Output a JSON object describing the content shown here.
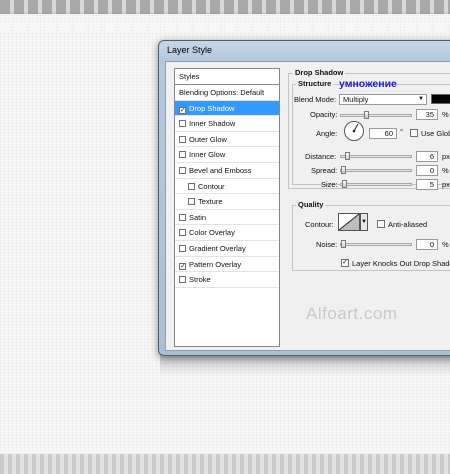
{
  "dialog": {
    "title": "Layer Style"
  },
  "styles_list": {
    "header": "Styles",
    "items": [
      {
        "label": "Blending Options: Default",
        "checkbox": false,
        "checked": false,
        "selected": false,
        "indent": false
      },
      {
        "label": "Drop Shadow",
        "checkbox": true,
        "checked": true,
        "selected": true,
        "indent": false
      },
      {
        "label": "Inner Shadow",
        "checkbox": true,
        "checked": false,
        "selected": false,
        "indent": false
      },
      {
        "label": "Outer Glow",
        "checkbox": true,
        "checked": false,
        "selected": false,
        "indent": false
      },
      {
        "label": "Inner Glow",
        "checkbox": true,
        "checked": false,
        "selected": false,
        "indent": false
      },
      {
        "label": "Bevel and Emboss",
        "checkbox": true,
        "checked": false,
        "selected": false,
        "indent": false
      },
      {
        "label": "Contour",
        "checkbox": true,
        "checked": false,
        "selected": false,
        "indent": true
      },
      {
        "label": "Texture",
        "checkbox": true,
        "checked": false,
        "selected": false,
        "indent": true
      },
      {
        "label": "Satin",
        "checkbox": true,
        "checked": false,
        "selected": false,
        "indent": false
      },
      {
        "label": "Color Overlay",
        "checkbox": true,
        "checked": false,
        "selected": false,
        "indent": false
      },
      {
        "label": "Gradient Overlay",
        "checkbox": true,
        "checked": false,
        "selected": false,
        "indent": false
      },
      {
        "label": "Pattern Overlay",
        "checkbox": true,
        "checked": true,
        "selected": false,
        "indent": false
      },
      {
        "label": "Stroke",
        "checkbox": true,
        "checked": false,
        "selected": false,
        "indent": false
      }
    ]
  },
  "drop_shadow": {
    "section_title": "Drop Shadow",
    "structure_title": "Structure",
    "annotation": "умножение",
    "blend_mode_label": "Blend Mode:",
    "blend_mode_value": "Multiply",
    "shadow_color": "#000000",
    "opacity_label": "Opacity:",
    "opacity_value": "35",
    "opacity_unit": "%",
    "angle_label": "Angle:",
    "angle_value": "60",
    "angle_unit": "°",
    "use_global_light_label": "Use Global",
    "distance_label": "Distance:",
    "distance_value": "6",
    "distance_unit": "px",
    "spread_label": "Spread:",
    "spread_value": "0",
    "spread_unit": "%",
    "size_label": "Size:",
    "size_value": "5",
    "size_unit": "px",
    "quality_title": "Quality",
    "contour_label": "Contour:",
    "anti_aliased_label": "Anti-aliased",
    "noise_label": "Noise:",
    "noise_value": "0",
    "noise_unit": "%",
    "knockout_label": "Layer Knocks Out Drop Shadow"
  },
  "watermark": "Alfoart.com",
  "colors": {
    "selection": "#3399ff",
    "annotation": "#1c1cc8"
  }
}
